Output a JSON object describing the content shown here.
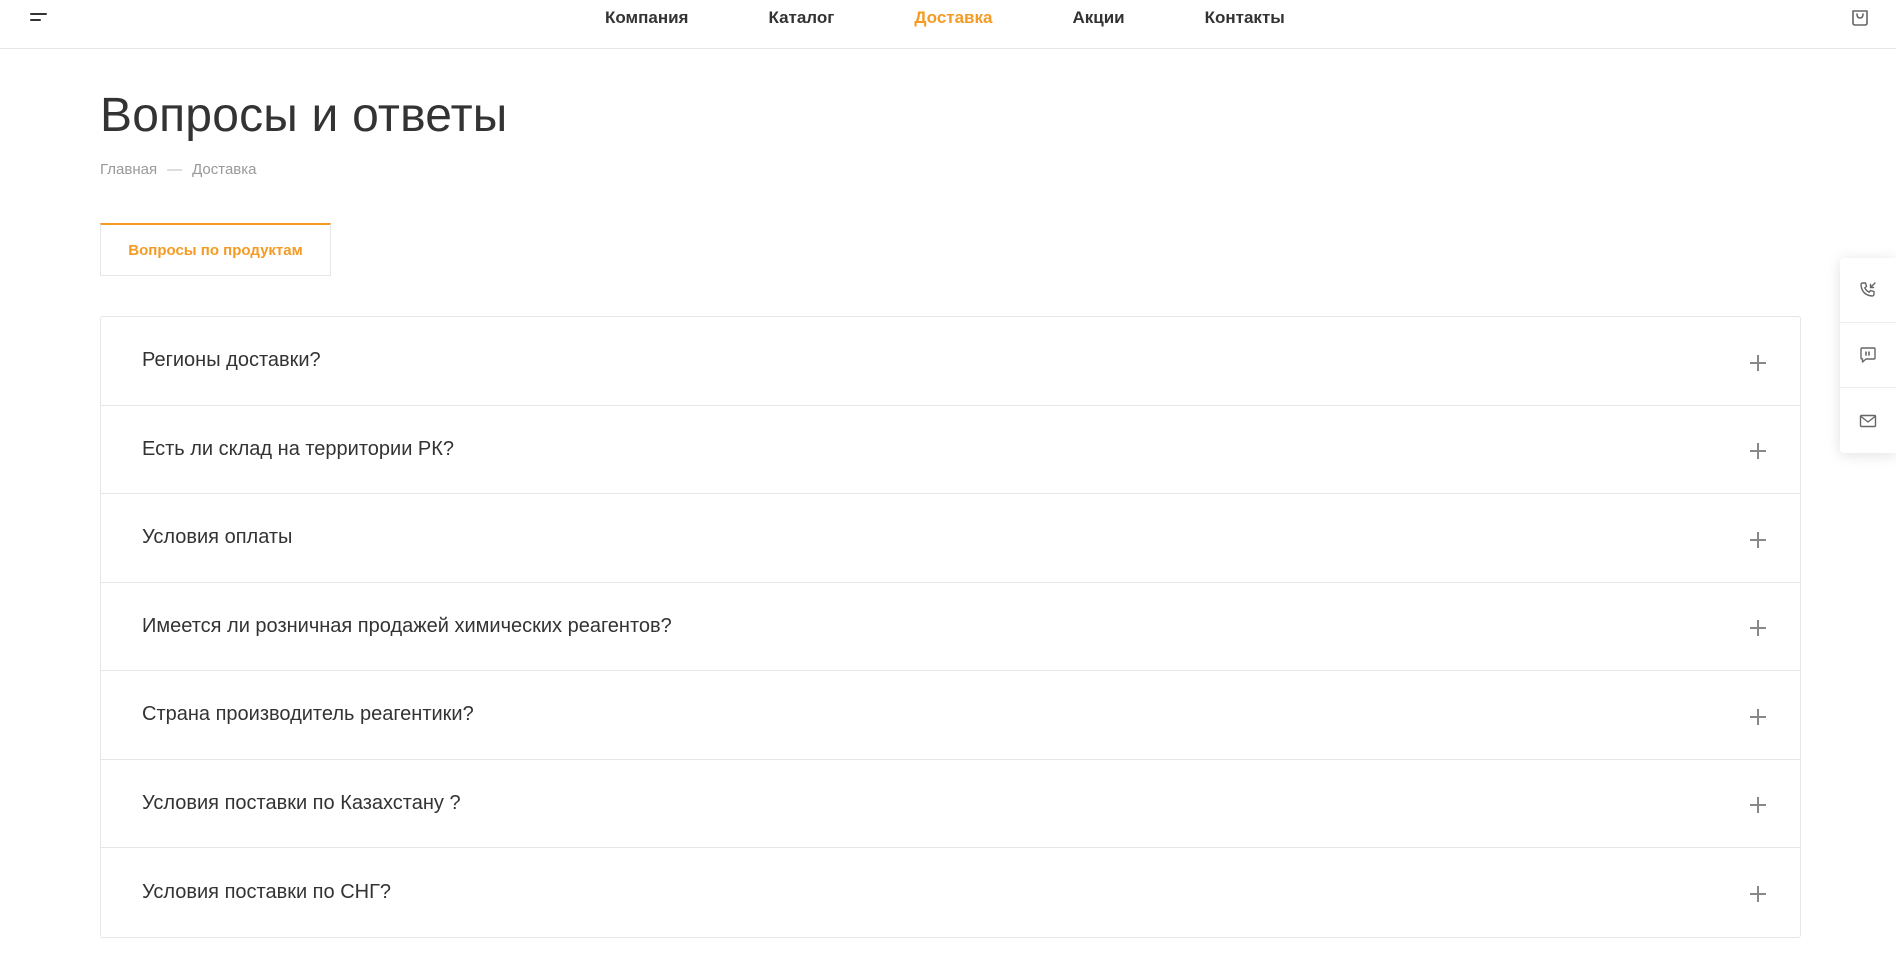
{
  "header": {
    "nav": [
      {
        "label": "Компания",
        "active": false
      },
      {
        "label": "Каталог",
        "active": false
      },
      {
        "label": "Доставка",
        "active": true
      },
      {
        "label": "Акции",
        "active": false
      },
      {
        "label": "Контакты",
        "active": false
      }
    ],
    "icons": {
      "menu": "menu-icon",
      "cart": "cart-icon"
    }
  },
  "page": {
    "title": "Вопросы и ответы",
    "breadcrumb": {
      "items": [
        "Главная",
        "Доставка"
      ],
      "separator": "—"
    },
    "tab_label": "Вопросы по продуктам"
  },
  "faq": {
    "items": [
      {
        "question": "Регионы доставки?"
      },
      {
        "question": "Есть ли склад на территории РК?"
      },
      {
        "question": "Условия оплаты"
      },
      {
        "question": "Имеется ли розничная продажей химических реагентов?"
      },
      {
        "question": "Страна производитель реагентики?"
      },
      {
        "question": "Условия поставки по Казахстану ?"
      },
      {
        "question": "Условия поставки по СНГ?"
      }
    ]
  },
  "side_panel": {
    "icons": [
      "phone-callback-icon",
      "chat-icon",
      "mail-icon"
    ]
  },
  "colors": {
    "accent": "#f59b24",
    "text": "#333333",
    "muted": "#999999",
    "border": "#e6e6e6"
  }
}
